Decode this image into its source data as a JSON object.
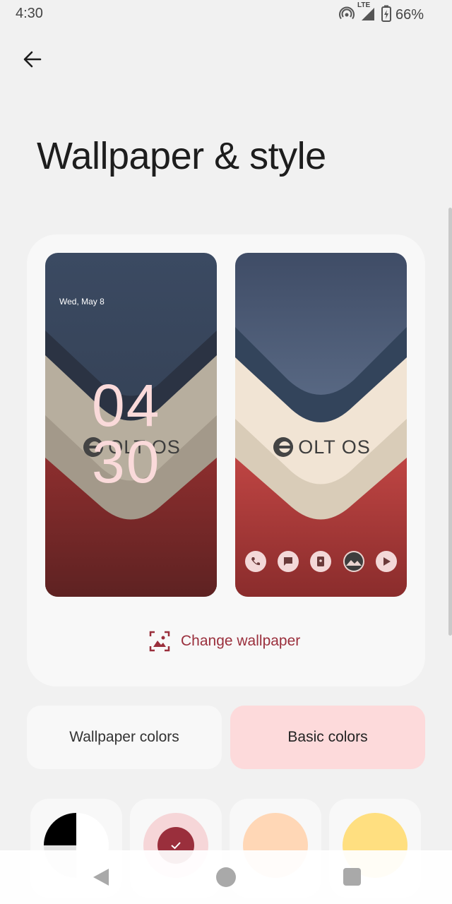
{
  "status": {
    "time": "4:30",
    "network": "LTE",
    "battery": "66%"
  },
  "header": {
    "title": "Wallpaper & style"
  },
  "preview": {
    "lock_date": "Wed, May 8",
    "clock_hours": "04",
    "clock_minutes": "30",
    "brand": "OLT OS",
    "change_wallpaper_label": "Change wallpaper",
    "dock_icons": [
      "phone-icon",
      "messages-icon",
      "contacts-icon",
      "photos-icon",
      "play-store-icon"
    ]
  },
  "tabs": {
    "wallpaper_colors": "Wallpaper colors",
    "basic_colors": "Basic colors",
    "selected": "Basic colors"
  },
  "colors": {
    "accent": "#9a2f3c",
    "selected_tab_bg": "#fddadb",
    "swatches": [
      {
        "name": "black-white",
        "color": "#000000"
      },
      {
        "name": "rose",
        "color": "#f6d6d8",
        "selected": true
      },
      {
        "name": "peach",
        "color": "#ffd7b6"
      },
      {
        "name": "yellow",
        "color": "#ffdf80"
      }
    ]
  }
}
